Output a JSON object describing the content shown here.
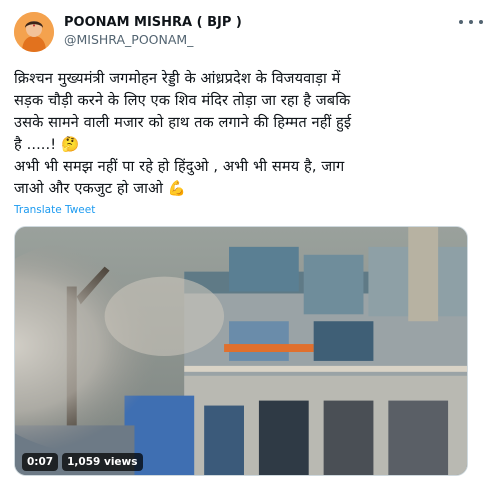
{
  "author": {
    "display_name": "POONAM MISHRA ( BJP )",
    "handle": "@MISHRA_POONAM_",
    "avatar_icon": "profile-avatar"
  },
  "tweet": {
    "text": "क्रिश्चन मुख्यमंत्री जगमोहन रेड्डी के आंध्रप्रदेश के विजयवाड़ा में\nसड़क चौड़ी करने के लिए एक शिव मंदिर तोड़ा जा रहा है जबकि\nउसके सामने वाली मजार को हाथ तक लगाने की हिम्मत नहीं हुई\nहै .....! 🤔\nअभी भी समझ नहीं पा रहे हो हिंदुओ , अभी भी समय है, जाग\nजाओ और एकजुट हो जाओ 💪",
    "translate_label": "Translate Tweet"
  },
  "video": {
    "duration": "0:07",
    "views": "1,059 views"
  },
  "colors": {
    "link": "#1d9bf0",
    "secondary_text": "#536471",
    "border": "#cfd9de"
  }
}
